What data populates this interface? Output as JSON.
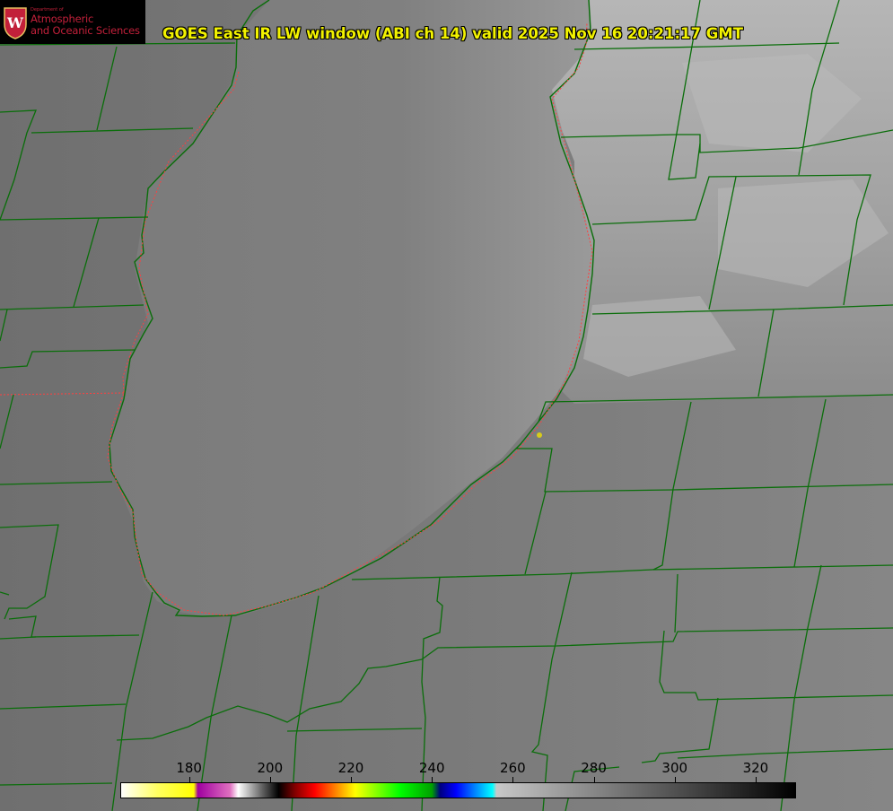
{
  "title": "GOES East IR LW window (ABI ch 14) valid 2025 Nov 16 20:21:17 GMT",
  "logo": {
    "dept": "Department of",
    "line1": "Atmospheric",
    "line2": "and Oceanic Sciences",
    "brand_color": "#c2203a"
  },
  "colorbar": {
    "ticks": [
      "180",
      "200",
      "220",
      "240",
      "260",
      "280",
      "300",
      "320"
    ],
    "range": [
      163,
      330
    ]
  },
  "colors": {
    "title": "#f2f200",
    "county_lines": "#0a6e0a",
    "state_dotted": "#ff4040",
    "station_marker": "#d8cc1a"
  }
}
